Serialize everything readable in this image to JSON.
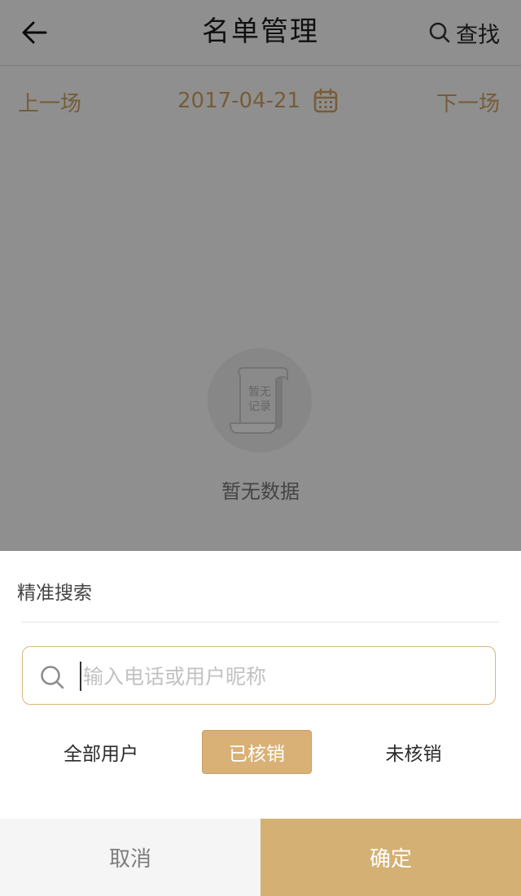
{
  "header": {
    "title": "名单管理",
    "back_icon": "arrow-left-icon",
    "find_label": "查找",
    "find_icon": "search-icon"
  },
  "date_nav": {
    "prev_label": "上一场",
    "date": "2017-04-21",
    "calendar_icon": "calendar-icon",
    "next_label": "下一场"
  },
  "empty_state": {
    "illustration_text_line1": "暂无",
    "illustration_text_line2": "记录",
    "message": "暂无数据"
  },
  "search_sheet": {
    "title": "精准搜索",
    "input_placeholder": "输入电话或用户昵称",
    "input_value": "",
    "filters": [
      {
        "label": "全部用户",
        "selected": false
      },
      {
        "label": "已核销",
        "selected": true
      },
      {
        "label": "未核销",
        "selected": false
      }
    ],
    "cancel_label": "取消",
    "confirm_label": "确定"
  },
  "colors": {
    "accent": "#d4b074",
    "accent_text": "#d4a464",
    "overlay": "rgba(0,0,0,0.44)"
  }
}
